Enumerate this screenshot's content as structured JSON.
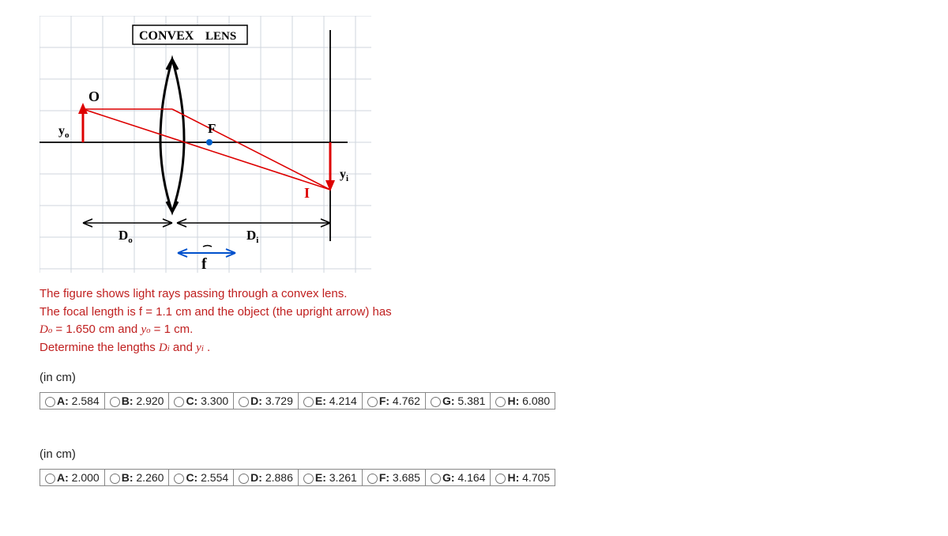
{
  "diagram": {
    "title_bold": "CONVEX",
    "title_rest": "LENS",
    "labels": {
      "O": "O",
      "yo": "y",
      "yo_sub": "o",
      "F": "F",
      "yi": "y",
      "yi_sub": "i",
      "I": "I",
      "Do": "D",
      "Do_sub": "o",
      "Di": "D",
      "Di_sub": "i",
      "f": "f"
    }
  },
  "question": {
    "line1": "The figure shows light rays passing through a convex lens.",
    "line2_a": "The focal length is f = ",
    "f_value": "1.1",
    "line2_b": " cm and the object (the upright arrow) has",
    "Do_prefix": "D",
    "Do_sub": "o",
    "Do_equals": " = ",
    "Do_value": "1.650",
    "Do_unit": " cm and ",
    "yo_prefix": "y",
    "yo_sub": "o",
    "yo_equals": " = ",
    "yo_value": "1",
    "yo_unit": " cm.",
    "line4_a": "Determine the lengths ",
    "Di_prefix": "D",
    "Di_sub": "i",
    "and": " and ",
    "yi_prefix": "y",
    "yi_sub": "i",
    "period": " ."
  },
  "unit_label": "(in cm)",
  "choices1": [
    {
      "letter": "A",
      "value": "2.584"
    },
    {
      "letter": "B",
      "value": "2.920"
    },
    {
      "letter": "C",
      "value": "3.300"
    },
    {
      "letter": "D",
      "value": "3.729"
    },
    {
      "letter": "E",
      "value": "4.214"
    },
    {
      "letter": "F",
      "value": "4.762"
    },
    {
      "letter": "G",
      "value": "5.381"
    },
    {
      "letter": "H",
      "value": "6.080"
    }
  ],
  "choices2": [
    {
      "letter": "A",
      "value": "2.000"
    },
    {
      "letter": "B",
      "value": "2.260"
    },
    {
      "letter": "C",
      "value": "2.554"
    },
    {
      "letter": "D",
      "value": "2.886"
    },
    {
      "letter": "E",
      "value": "3.261"
    },
    {
      "letter": "F",
      "value": "3.685"
    },
    {
      "letter": "G",
      "value": "4.164"
    },
    {
      "letter": "H",
      "value": "4.705"
    }
  ]
}
